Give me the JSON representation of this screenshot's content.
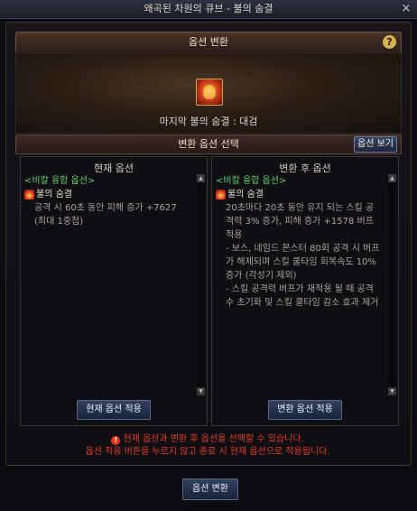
{
  "window": {
    "title": "왜곡된 차원의 큐브 - 불의 숨결",
    "close_label": "×"
  },
  "header": {
    "title": "옵션 변환",
    "help_label": "?"
  },
  "item": {
    "icon": "fire-breath-item-icon",
    "name": "마지막 불의 숨결 : 대검"
  },
  "select_bar": {
    "title": "변환 옵션 선택",
    "view_button": "옵션 보기"
  },
  "current": {
    "title": "현재 옵션",
    "set_name": "<비칼 융합 옵션>",
    "option_name": "불의 숨결",
    "option_text": "공격 시 60초 동안 피해 증가 +7627 (최대 1중첩)",
    "apply_button": "현재 옵션 적용"
  },
  "after": {
    "title": "변환 후 옵션",
    "set_name": "<비칼 융합 옵션>",
    "option_name": "불의 숨결",
    "option_text": "20초마다 20초 동안 유지 되는 스킬 공격력 3% 증가, 피해 증가 +1578 버프 적용\n- 보스, 네임드 몬스터 80회 공격 시 버프가 해제되며 스킬 쿨타임 회복속도 10% 증가 (각성기 제외)\n- 스킬 공격력 버프가 재적용 될 때 공격 수 초기화 및 스킬 쿨타임 감소 효과 제거",
    "apply_button": "변환 옵션 적용"
  },
  "notice": {
    "icon_label": "!",
    "line1": "현재 옵션과 변환 후 옵션을 선택할 수 있습니다.",
    "line2": "옵션 적용 버튼을 누르지 않고 종료 시 현재 옵션으로 적용됩니다."
  },
  "footer": {
    "convert_button": "옵션 변환"
  },
  "colors": {
    "set_name": "#5fd06a",
    "notice": "#e0392a",
    "button": "#33425f",
    "help": "#d4b44a"
  }
}
